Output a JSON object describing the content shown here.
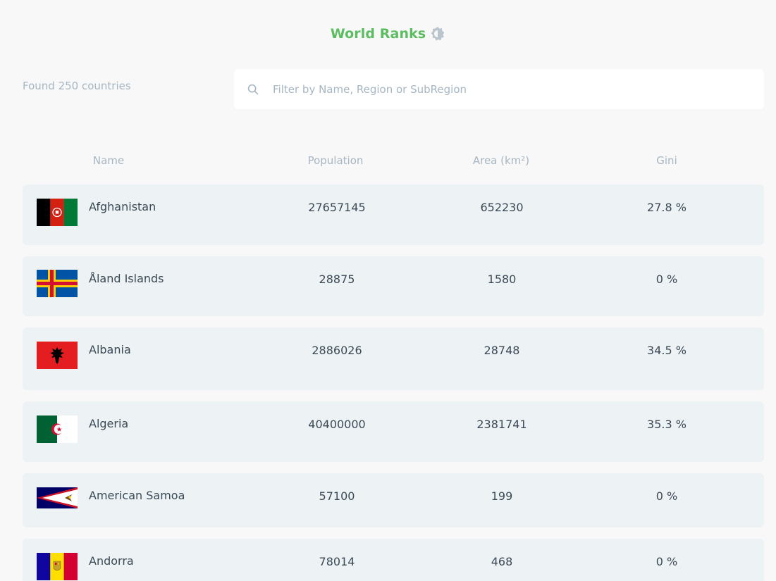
{
  "header": {
    "title": "World Ranks",
    "theme_icon": "contrast-icon",
    "accent_color": "#5cbd60"
  },
  "toolbar": {
    "count_text": "Found 250 countries",
    "search_placeholder": "Filter by Name, Region or SubRegion",
    "search_value": ""
  },
  "table": {
    "columns": [
      "Name",
      "Population",
      "Area (km²)",
      "Gini"
    ],
    "rows": [
      {
        "name": "Afghanistan",
        "population": "27657145",
        "area": "652230",
        "gini": "27.8 %"
      },
      {
        "name": "Åland Islands",
        "population": "28875",
        "area": "1580",
        "gini": "0 %"
      },
      {
        "name": "Albania",
        "population": "2886026",
        "area": "28748",
        "gini": "34.5 %"
      },
      {
        "name": "Algeria",
        "population": "40400000",
        "area": "2381741",
        "gini": "35.3 %"
      },
      {
        "name": "American Samoa",
        "population": "57100",
        "area": "199",
        "gini": "0 %"
      },
      {
        "name": "Andorra",
        "population": "78014",
        "area": "468",
        "gini": "0 %"
      }
    ]
  }
}
